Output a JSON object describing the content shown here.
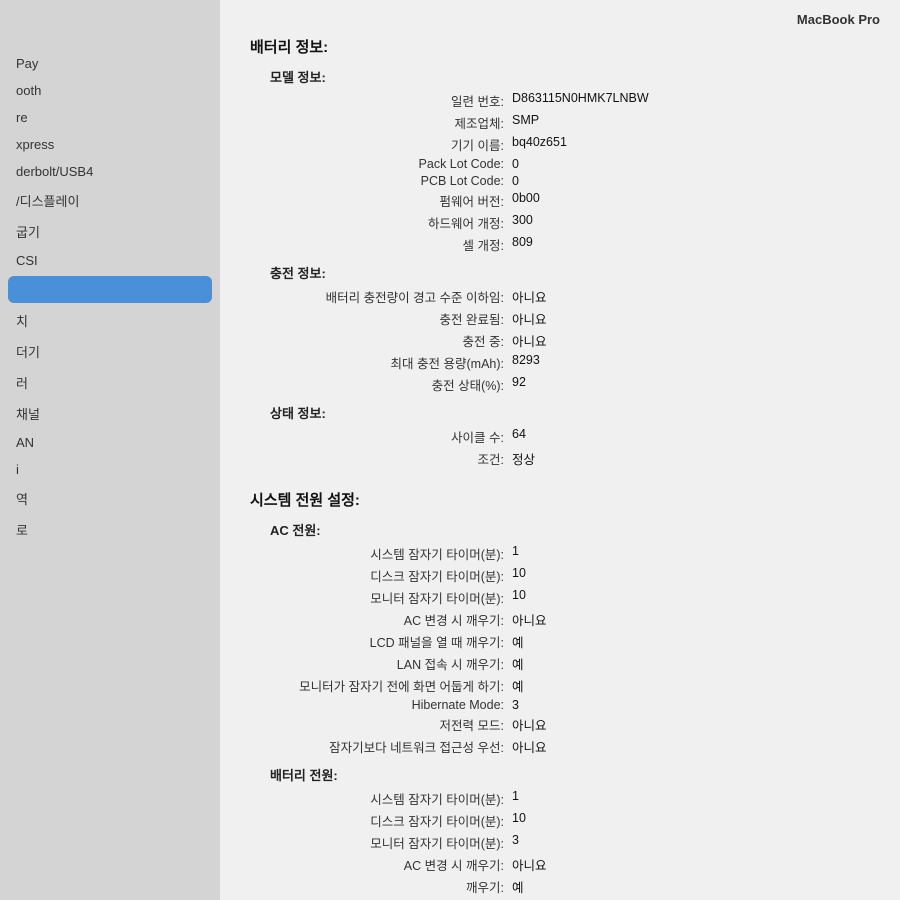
{
  "window": {
    "title": "MacBook Pro"
  },
  "sidebar": {
    "items": [
      {
        "label": "Pay",
        "active": false
      },
      {
        "label": "ooth",
        "active": false
      },
      {
        "label": "re",
        "active": false
      },
      {
        "label": "xpress",
        "active": false
      },
      {
        "label": "derbolt/USB4",
        "active": false
      },
      {
        "label": "/디스플레이",
        "active": false
      },
      {
        "label": "굽기",
        "active": false
      },
      {
        "label": "CSI",
        "active": false
      },
      {
        "label": "",
        "active": true
      },
      {
        "label": "치",
        "active": false
      },
      {
        "label": "더기",
        "active": false
      },
      {
        "label": "러",
        "active": false
      },
      {
        "label": "채널",
        "active": false
      },
      {
        "label": "AN",
        "active": false
      },
      {
        "label": "i",
        "active": false
      },
      {
        "label": "역",
        "active": false
      },
      {
        "label": "로",
        "active": false
      }
    ]
  },
  "battery_section": {
    "title": "배터리 정보:",
    "model_title": "모델 정보:",
    "fields": [
      {
        "label": "일련 번호:",
        "value": "D863115N0HMK7LNBW"
      },
      {
        "label": "제조업체:",
        "value": "SMP"
      },
      {
        "label": "기기 이름:",
        "value": "bq40z651"
      },
      {
        "label": "Pack Lot Code:",
        "value": "0"
      },
      {
        "label": "PCB Lot Code:",
        "value": "0"
      },
      {
        "label": "펌웨어 버전:",
        "value": "0b00"
      },
      {
        "label": "하드웨어 개정:",
        "value": "300"
      },
      {
        "label": "셀 개정:",
        "value": "809"
      }
    ],
    "charge_title": "충전 정보:",
    "charge_fields": [
      {
        "label": "배터리 충전량이 경고 수준 이하임:",
        "value": "아니요"
      },
      {
        "label": "충전 완료됨:",
        "value": "아니요"
      },
      {
        "label": "충전 중:",
        "value": "아니요"
      },
      {
        "label": "최대 충전 용량(mAh):",
        "value": "8293"
      },
      {
        "label": "충전 상태(%):",
        "value": "92"
      }
    ],
    "status_title": "상태 정보:",
    "status_fields": [
      {
        "label": "사이클 수:",
        "value": "64"
      },
      {
        "label": "조건:",
        "value": "정상"
      }
    ]
  },
  "power_section": {
    "title": "시스템 전원 설정:",
    "ac_title": "AC 전원:",
    "ac_fields": [
      {
        "label": "시스템 잠자기 타이머(분):",
        "value": "1"
      },
      {
        "label": "디스크 잠자기 타이머(분):",
        "value": "10"
      },
      {
        "label": "모니터 잠자기 타이머(분):",
        "value": "10"
      },
      {
        "label": "AC 변경 시 깨우기:",
        "value": "아니요"
      },
      {
        "label": "LCD 패널을 열 때 깨우기:",
        "value": "예"
      },
      {
        "label": "LAN 접속 시 깨우기:",
        "value": "예"
      },
      {
        "label": "모니터가 잠자기 전에 화면 어둡게 하기:",
        "value": "예"
      },
      {
        "label": "Hibernate Mode:",
        "value": "3"
      },
      {
        "label": "저전력 모드:",
        "value": "아니요"
      },
      {
        "label": "잠자기보다 네트워크 접근성 우선:",
        "value": "아니요"
      }
    ],
    "battery_power_title": "배터리 전원:",
    "battery_power_fields": [
      {
        "label": "시스템 잠자기 타이머(분):",
        "value": "1"
      },
      {
        "label": "디스크 잠자기 타이머(분):",
        "value": "10"
      },
      {
        "label": "모니터 잠자기 타이머(분):",
        "value": "3"
      },
      {
        "label": "AC 변경 시 깨우기:",
        "value": "아니요"
      },
      {
        "label": "깨우기:",
        "value": "예"
      }
    ]
  }
}
